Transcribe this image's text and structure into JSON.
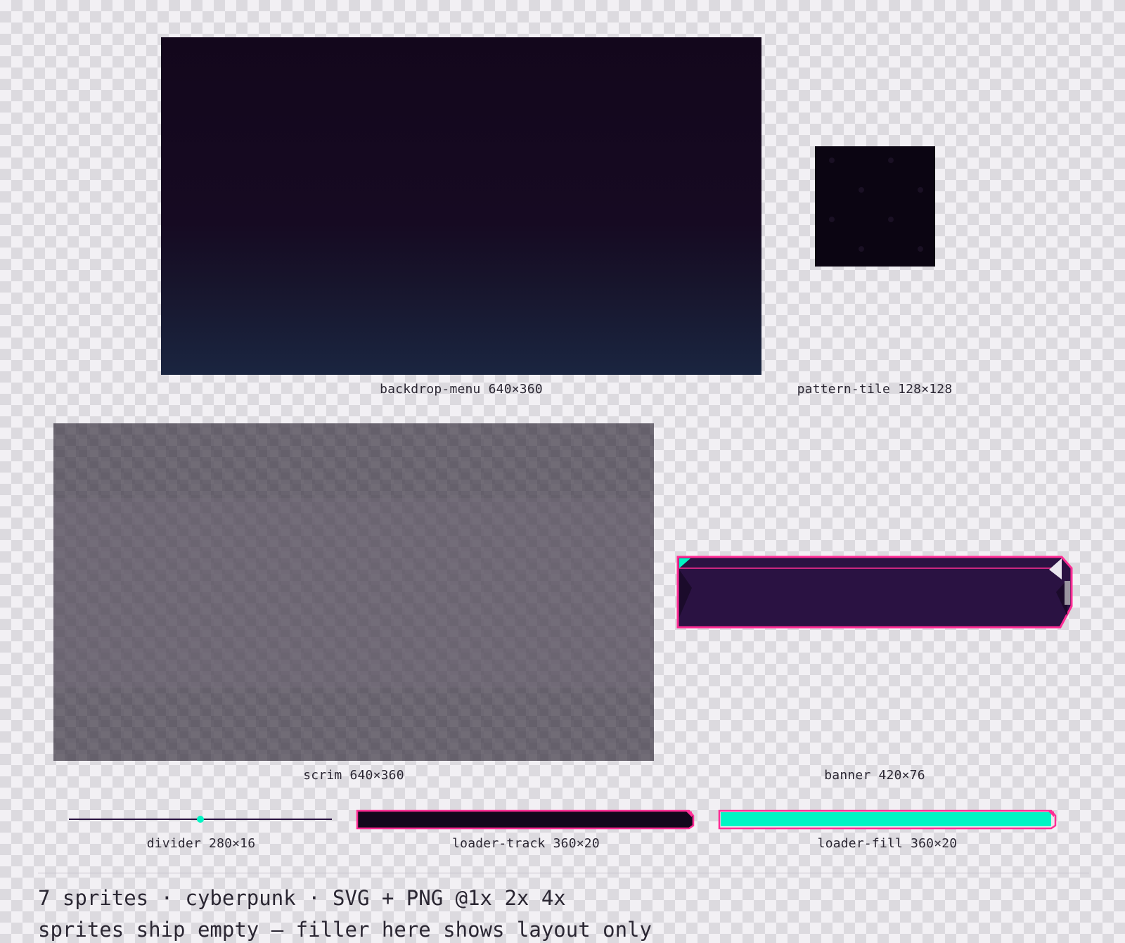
{
  "sprites": {
    "backdrop_menu": {
      "caption": "backdrop-menu 640×360"
    },
    "pattern_tile": {
      "caption": "pattern-tile 128×128"
    },
    "scrim": {
      "caption": "scrim 640×360"
    },
    "banner": {
      "caption": "banner 420×76"
    },
    "divider": {
      "caption": "divider 280×16"
    },
    "loader_track": {
      "caption": "loader-track 360×20"
    },
    "loader_fill": {
      "caption": "loader-fill 360×20"
    }
  },
  "footer": {
    "line1": "7 sprites · cyberpunk · SVG + PNG @1x 2x 4x",
    "line2": "sprites ship empty — filler here shows layout only"
  },
  "colors": {
    "accent_pink": "#ff2d95",
    "accent_cyan": "#00f5c4",
    "deep_purple": "#2a1242",
    "dark_base": "#13071c"
  },
  "loader_fill_level": 1.0
}
